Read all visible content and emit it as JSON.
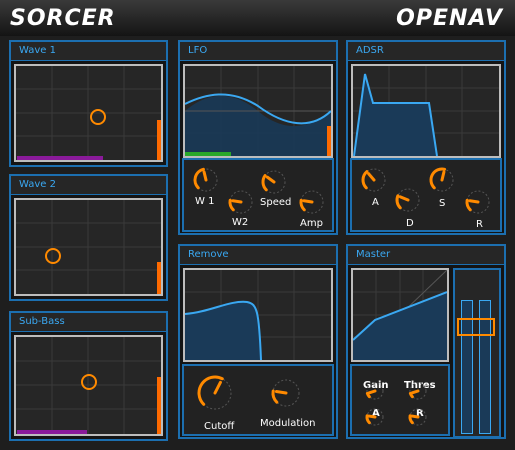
{
  "header": {
    "app_name": "SORCER",
    "brand": "OPENAV"
  },
  "wave1": {
    "title": "Wave 1"
  },
  "wave2": {
    "title": "Wave 2"
  },
  "subbass": {
    "title": "Sub-Bass"
  },
  "lfo": {
    "title": "LFO",
    "knobs": [
      {
        "label": "W 1",
        "value": 0.45
      },
      {
        "label": "W2",
        "value": 0.2
      },
      {
        "label": "Speed",
        "value": 0.3
      },
      {
        "label": "Amp",
        "value": 0.2
      }
    ]
  },
  "adsr": {
    "title": "ADSR",
    "knobs": [
      {
        "label": "A",
        "value": 0.35
      },
      {
        "label": "D",
        "value": 0.25
      },
      {
        "label": "S",
        "value": 0.55
      },
      {
        "label": "R",
        "value": 0.2
      }
    ]
  },
  "remove": {
    "title": "Remove",
    "knobs": [
      {
        "label": "Cutoff",
        "value": 0.6
      },
      {
        "label": "Modulation",
        "value": 0.2
      }
    ]
  },
  "master": {
    "title": "Master",
    "knobs": [
      {
        "label": "Gain",
        "value": 0.1
      },
      {
        "label": "Thres",
        "value": 0.1
      },
      {
        "label": "A",
        "value": 0.2
      },
      {
        "label": "R",
        "value": 0.2
      }
    ]
  },
  "colors": {
    "accent": "#ff8a00",
    "panel_border": "#1c6fb0",
    "title_text": "#3aa8f2",
    "purple": "#8a1a9a",
    "green": "#2aa82a"
  }
}
